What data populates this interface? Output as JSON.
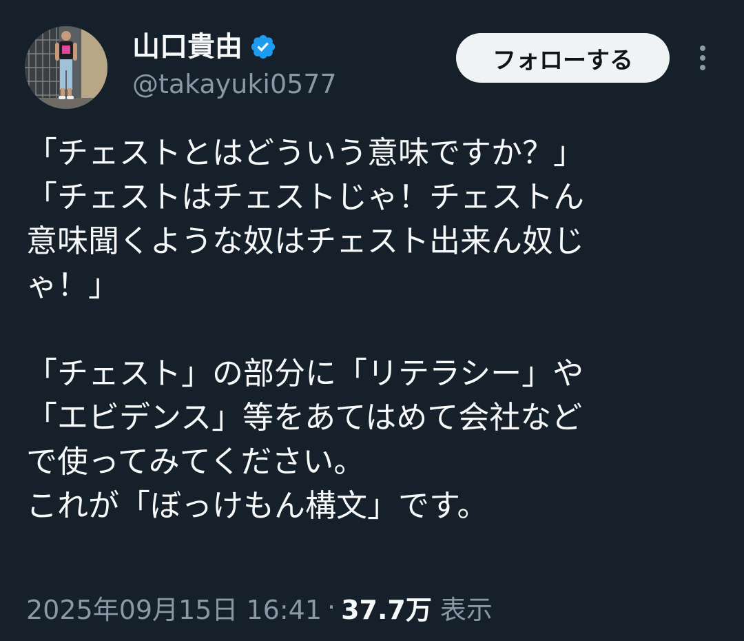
{
  "author": {
    "display_name": "山口貴由",
    "handle": "@takayuki0577",
    "verified": true,
    "verified_color": "#1d9bf0"
  },
  "actions": {
    "follow_label": "フォローする",
    "more_icon": "more-vertical-icon"
  },
  "tweet": {
    "lines": [
      "「チェストとはどういう意味ですか？」",
      "「チェストはチェストじゃ！チェストん",
      "意味聞くような奴はチェスト出来ん奴じ",
      "ゃ！」",
      "",
      "「チェスト」の部分に「リテラシー」や",
      "「エビデンス」等をあてはめて会社など",
      "で使ってみてください。",
      "これが「ぼっけもん構文」です。"
    ]
  },
  "meta": {
    "timestamp": "2025年09月15日 16:41",
    "separator": "·",
    "views_count": "37.7万",
    "views_label": "表示"
  },
  "colors": {
    "background": "#15202b",
    "text_primary": "#f7f9f9",
    "text_secondary": "#8b98a5",
    "follow_bg": "#eff3f4"
  }
}
